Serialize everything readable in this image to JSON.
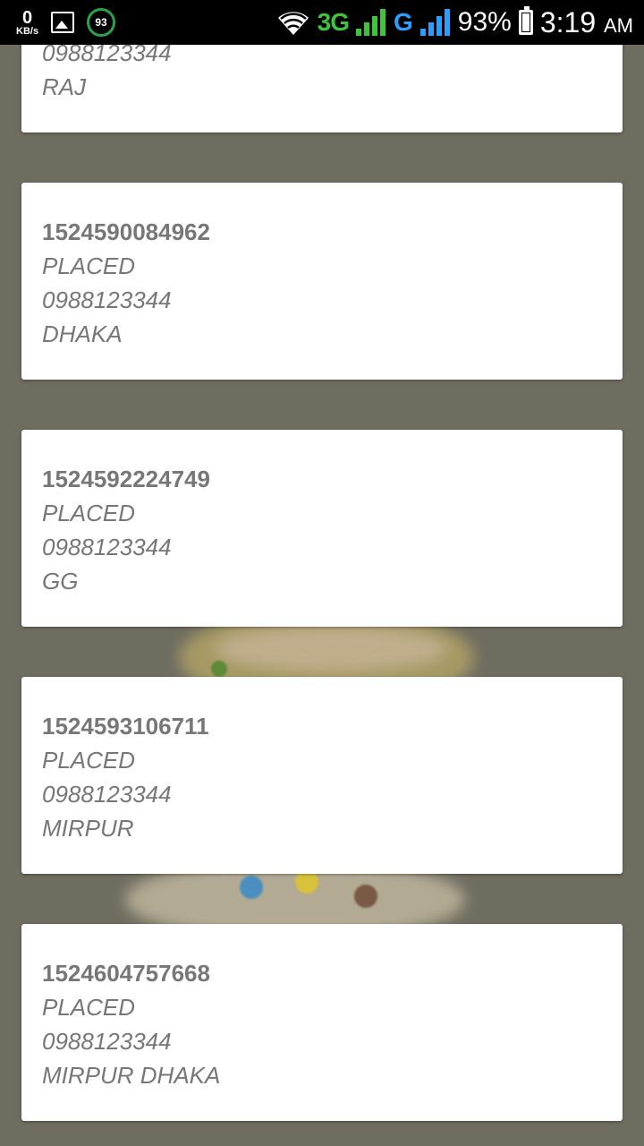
{
  "status_bar": {
    "speed_value": "0",
    "speed_unit": "KB/s",
    "battery_saver_level": "93",
    "network_1": "3G",
    "network_2": "G",
    "battery_percent": "93%",
    "time": "3:19",
    "ampm": "AM",
    "colors": {
      "network_3g": "#3ec53a",
      "network_g": "#2b9fff"
    }
  },
  "orders": [
    {
      "id": "",
      "status": "",
      "phone": "0988123344",
      "address": "RAJ"
    },
    {
      "id": "1524590084962",
      "status": "PLACED",
      "phone": "0988123344",
      "address": "DHAKA"
    },
    {
      "id": "1524592224749",
      "status": "PLACED",
      "phone": "0988123344",
      "address": "GG"
    },
    {
      "id": "1524593106711",
      "status": "PLACED",
      "phone": "0988123344",
      "address": "MIRPUR"
    },
    {
      "id": "1524604757668",
      "status": "PLACED",
      "phone": "0988123344",
      "address": "MIRPUR DHAKA"
    }
  ]
}
